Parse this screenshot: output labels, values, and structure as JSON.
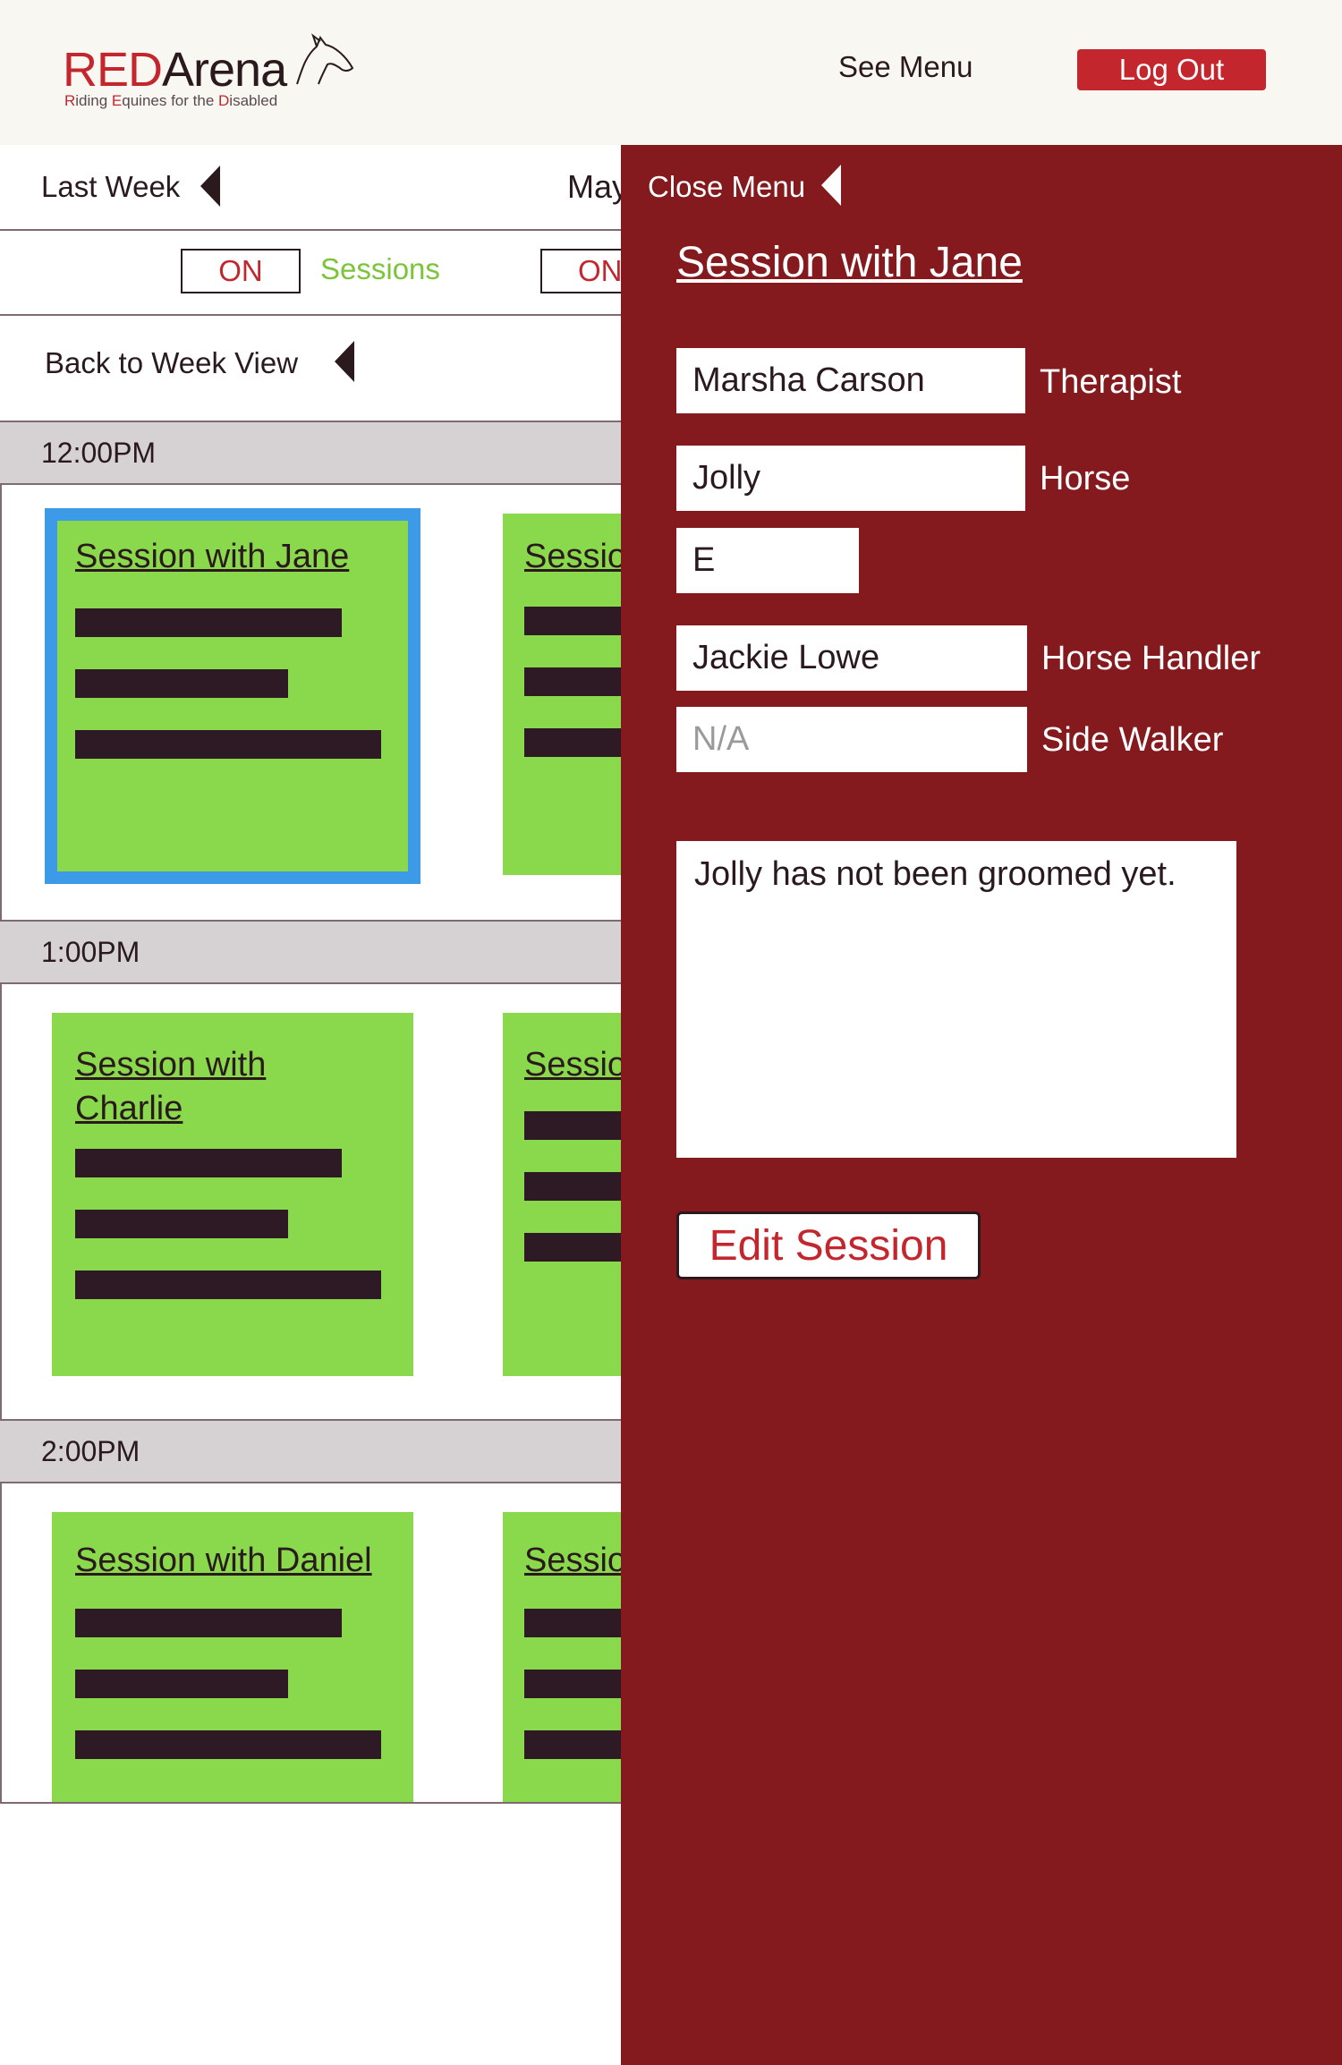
{
  "header": {
    "logo_red": "RED",
    "logo_dark": "Arena",
    "logo_tag_parts": [
      "R",
      "iding ",
      "E",
      "quines for the ",
      "D",
      "isabled"
    ],
    "see_menu": "See Menu",
    "logout": "Log Out"
  },
  "week_nav": {
    "last_week": "Last Week",
    "month": "May"
  },
  "toggles": {
    "on_label": "ON",
    "sessions_label": "Sessions",
    "on_label_2": "ON"
  },
  "back": {
    "label": "Back to Week View"
  },
  "schedule": {
    "slots": [
      {
        "time": "12:00PM",
        "cards": [
          "Session with Jane",
          "Session"
        ]
      },
      {
        "time": "1:00PM",
        "cards": [
          "Session with Charlie",
          "Session"
        ]
      },
      {
        "time": "2:00PM",
        "cards": [
          "Session with Daniel",
          "Session"
        ]
      }
    ]
  },
  "panel": {
    "close_menu": "Close Menu",
    "title": "Session with Jane",
    "therapist_value": "Marsha Carson",
    "therapist_label": "Therapist",
    "horse_value": "Jolly",
    "horse_label": "Horse",
    "horse_code": "E",
    "handler_value": "Jackie Lowe",
    "handler_label": "Horse Handler",
    "sidewalker_placeholder": "N/A",
    "sidewalker_label": "Side Walker",
    "notes": "Jolly has not been groomed yet.",
    "edit_button": "Edit Session"
  },
  "colors": {
    "brand_red": "#c4262e",
    "panel_bg": "#841a1e",
    "card_green": "#8ad94c",
    "selected_blue": "#3d9ae6",
    "sessions_green": "#7cc43a"
  }
}
